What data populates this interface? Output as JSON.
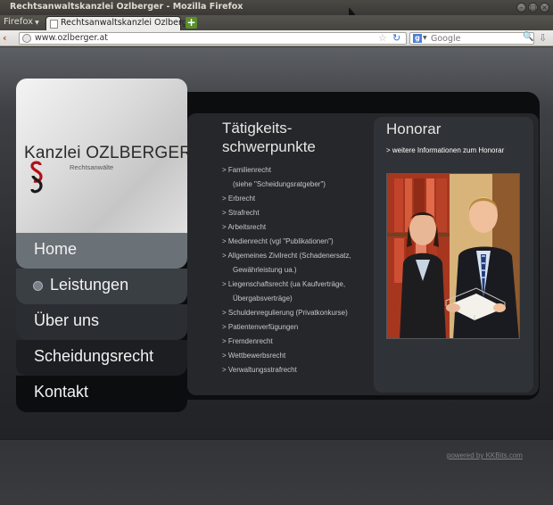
{
  "window": {
    "title": "Rechtsanwaltskanzlei Ozlberger - Mozilla Firefox",
    "controls": [
      "minimize-icon",
      "maximize-icon",
      "close-icon"
    ]
  },
  "browser": {
    "menu_label": "Firefox",
    "tab_title": "Rechtsanwaltskanzlei Ozlberger",
    "url": "www.ozlberger.at",
    "search_placeholder": "Google",
    "search_engine_icon": "google-icon"
  },
  "site": {
    "logo": {
      "name_part1": "Kanzlei ",
      "name_part2": "OZLBERGER",
      "subtitle": "Rechtsanwälte"
    },
    "nav": [
      {
        "label": "Home"
      },
      {
        "label": "Leistungen"
      },
      {
        "label": "Über uns"
      },
      {
        "label": "Scheidungsrecht"
      },
      {
        "label": "Kontakt"
      }
    ],
    "services_title": "Tätigkeits-schwerpunkte",
    "services_title_line1": "Tätigkeits-",
    "services_title_line2": "schwerpunkte",
    "services": [
      {
        "text": "> Familienrecht",
        "sub": "(siehe \"Scheidungsratgeber\")"
      },
      {
        "text": "> Erbrecht"
      },
      {
        "text": "> Strafrecht"
      },
      {
        "text": "> Arbeitsrecht"
      },
      {
        "text": "> Medienrecht (vgl \"Publikationen\")"
      },
      {
        "text": "> Allgemeines Zivilrecht (Schadenersatz,",
        "sub": "Gewährleistung ua.)"
      },
      {
        "text": "> Liegenschaftsrecht (ua Kaufverträge,",
        "sub": "Übergabsverträge)"
      },
      {
        "text": "> Schuldenregulierung (Privatkonkurse)"
      },
      {
        "text": "> Patientenverfügungen"
      },
      {
        "text": "> Fremdenrecht"
      },
      {
        "text": "> Wettbewerbsrecht"
      },
      {
        "text": "> Verwaltungsstrafrecht"
      }
    ],
    "honorar": {
      "title": "Honorar",
      "link": "> weitere Informationen zum Honorar"
    },
    "footer": {
      "powered": "powered by KKBits.com"
    }
  },
  "colors": {
    "page_bg": "#2c2e31",
    "nav_active": "#6a7177",
    "panel": "#25272a",
    "text": "#c5c8cb"
  }
}
